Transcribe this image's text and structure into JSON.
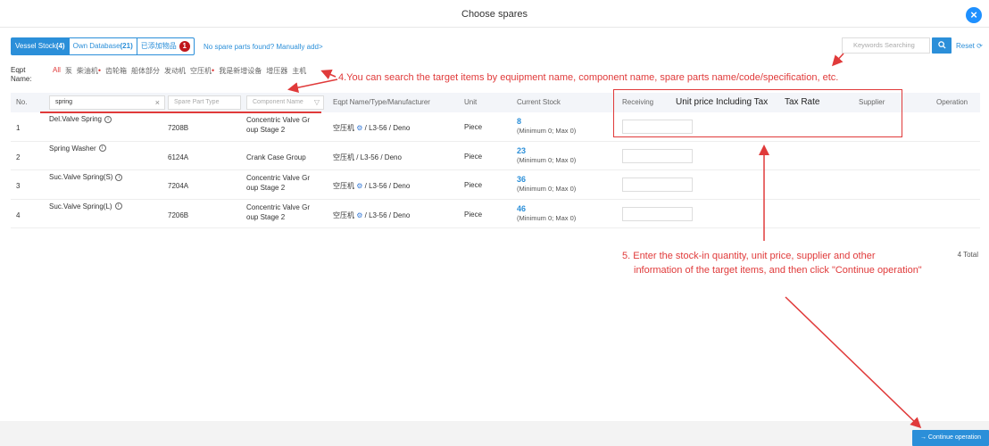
{
  "dialog": {
    "title": "Choose spares"
  },
  "tabs": [
    {
      "label": "Vessel Stock",
      "count": "(4)",
      "active": true
    },
    {
      "label": "Own Database",
      "count": "(21)",
      "active": false
    },
    {
      "label": "已添加物品",
      "badge": "1",
      "active": false
    }
  ],
  "manual_add": "No spare parts found? Manually add>",
  "search": {
    "placeholder": "Keywords Searching",
    "reset_label": "Reset"
  },
  "eqpt": {
    "label": "Eqpt Name:",
    "items": [
      {
        "label": "All",
        "active": true,
        "dot": false
      },
      {
        "label": "泵",
        "active": false,
        "dot": false
      },
      {
        "label": "柴油机",
        "active": false,
        "dot": true
      },
      {
        "label": "齿轮箱",
        "active": false,
        "dot": false
      },
      {
        "label": "船体部分",
        "active": false,
        "dot": false
      },
      {
        "label": "发动机",
        "active": false,
        "dot": false
      },
      {
        "label": "空压机",
        "active": false,
        "dot": true
      },
      {
        "label": "我是新增设备",
        "active": false,
        "dot": false
      },
      {
        "label": "增压器",
        "active": false,
        "dot": false
      },
      {
        "label": "主机",
        "active": false,
        "dot": false
      }
    ]
  },
  "annotations": {
    "search_tip": "4.You can search the target items by equipment name, component name, spare parts name/code/specification, etc.",
    "entry_tip_line1": "5. Enter the stock-in quantity, unit price, supplier and other",
    "entry_tip_line2": "information of the target items, and then click \"Continue operation\""
  },
  "table": {
    "headers": {
      "no": "No.",
      "eqpt": "Eqpt Name/Type/Manufacturer",
      "unit": "Unit",
      "stock": "Current Stock",
      "receiving": "Receiving",
      "price": "Unit price Including Tax",
      "tax": "Tax Rate",
      "supplier": "Supplier",
      "operation": "Operation"
    },
    "filters": {
      "spare_name": "spring",
      "part_type_placeholder": "Spare Part Type",
      "component_placeholder": "Component Name"
    },
    "rows": [
      {
        "no": "1",
        "name": "Del.Valve Spring",
        "code": "7208B",
        "component": [
          "Concentric Valve Gr",
          "oup Stage 2"
        ],
        "eqpt": "空压机",
        "eqpt_rest": " / L3-56 / Deno",
        "has_icon": true,
        "unit": "Piece",
        "stock": "8",
        "range": "(Minimum 0; Max 0)"
      },
      {
        "no": "2",
        "name": "Spring Washer",
        "code": "6124A",
        "component": [
          "Crank Case Group",
          ""
        ],
        "eqpt": "空压机",
        "eqpt_rest": " / L3-56 / Deno",
        "has_icon": false,
        "unit": "Piece",
        "stock": "23",
        "range": "(Minimum 0; Max 0)"
      },
      {
        "no": "3",
        "name": "Suc.Valve Spring(S)",
        "code": "7204A",
        "component": [
          "Concentric Valve Gr",
          "oup Stage 2"
        ],
        "eqpt": "空压机",
        "eqpt_rest": " / L3-56 / Deno",
        "has_icon": true,
        "unit": "Piece",
        "stock": "36",
        "range": "(Minimum 0; Max 0)"
      },
      {
        "no": "4",
        "name": "Suc.Valve Spring(L)",
        "code": "7206B",
        "component": [
          "Concentric Valve Gr",
          "oup Stage 2"
        ],
        "eqpt": "空压机",
        "eqpt_rest": " / L3-56 / Deno",
        "has_icon": true,
        "unit": "Piece",
        "stock": "46",
        "range": "(Minimum 0; Max 0)"
      }
    ],
    "total": "4 Total"
  },
  "footer": {
    "continue_label": "Continue operation"
  },
  "colors": {
    "primary": "#2b8fd9",
    "annotation": "#e03a3a",
    "badge": "#c0161c"
  }
}
